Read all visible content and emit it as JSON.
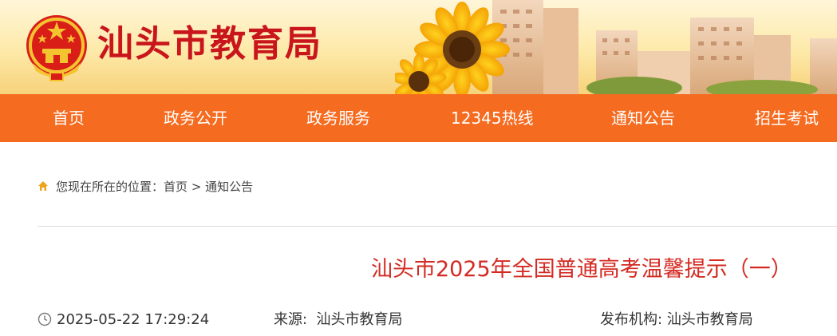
{
  "header": {
    "site_title": "汕头市教育局",
    "emblem_icon": "national-emblem-icon",
    "brand_red": "#c9161c"
  },
  "nav": {
    "background": "#f56b1f",
    "items": [
      {
        "label": "首页"
      },
      {
        "label": "政务公开"
      },
      {
        "label": "政务服务"
      },
      {
        "label": "12345热线"
      },
      {
        "label": "通知公告"
      },
      {
        "label": "招生考试"
      }
    ]
  },
  "breadcrumb": {
    "icon": "home-icon",
    "prefix": "您现在所在的位置：",
    "items": [
      "首页",
      "通知公告"
    ],
    "separator": ">"
  },
  "article": {
    "title": "汕头市2025年全国普通高考温馨提示（一）",
    "title_color": "#d42a22",
    "datetime": "2025-05-22 17:29:24",
    "source_label": "来源:",
    "source_value": "汕头市教育局",
    "publisher_label": "发布机构:",
    "publisher_value": "汕头市教育局"
  }
}
